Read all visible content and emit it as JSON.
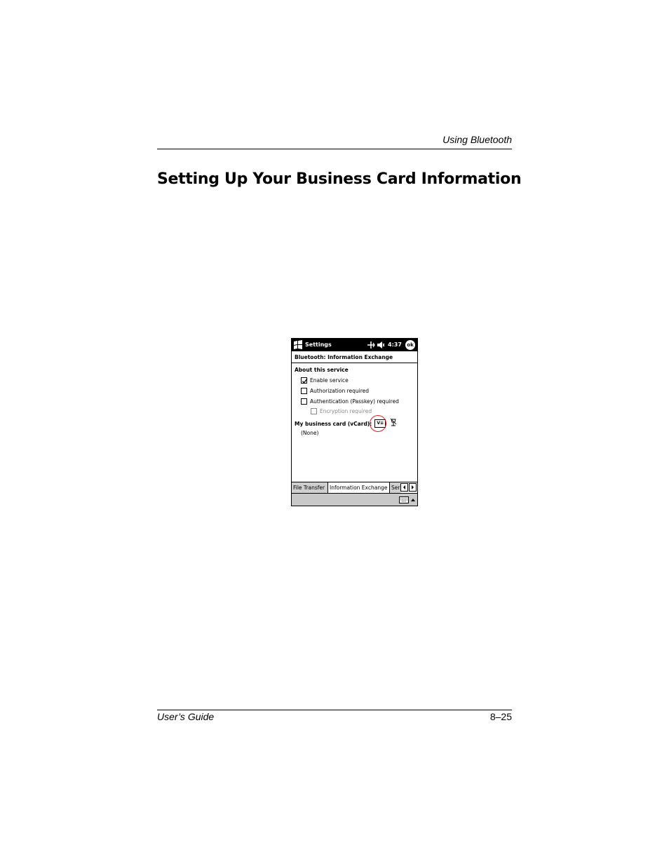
{
  "page": {
    "running_head": "Using Bluetooth",
    "heading": "Setting Up Your Business Card Information",
    "footer_left": "User’s Guide",
    "footer_right": "8–25"
  },
  "screenshot": {
    "titlebar": {
      "app_title": "Settings",
      "clock": "4:37",
      "ok_label": "ok",
      "icons": [
        "start-menu-icon",
        "connectivity-icon",
        "speaker-icon"
      ]
    },
    "subtitle": "Bluetooth: Information Exchange",
    "section_label": "About this service",
    "options": [
      {
        "label": "Enable service",
        "checked": true,
        "enabled": true
      },
      {
        "label": "Authorization required",
        "checked": false,
        "enabled": true
      },
      {
        "label": "Authentication (Passkey) required",
        "checked": false,
        "enabled": true
      },
      {
        "label": "Encryption required",
        "checked": false,
        "enabled": false
      }
    ],
    "vcard": {
      "label": "My business card (vCard):",
      "button_label": "V≡",
      "value": "(None)",
      "highlight_color": "#dd2222"
    },
    "tabs": [
      "File Transfer",
      "Information Exchange",
      "Ser"
    ],
    "active_tab": "Information Exchange"
  }
}
